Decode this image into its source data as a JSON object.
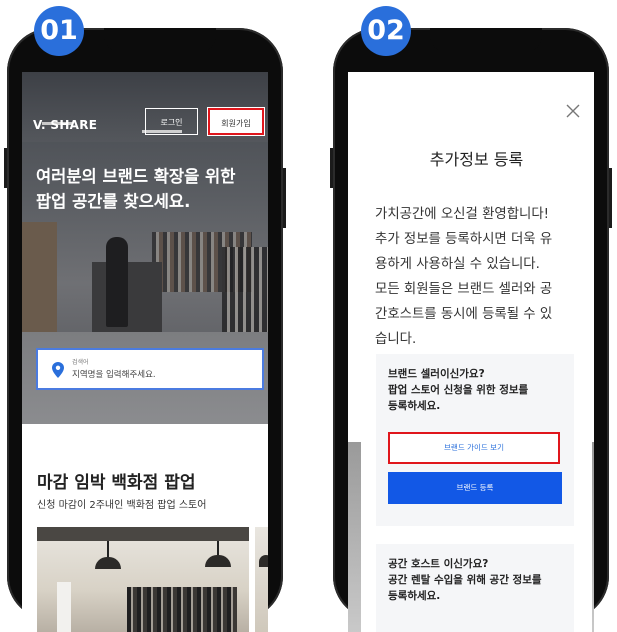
{
  "badges": {
    "step1": "01",
    "step2": "02"
  },
  "colors": {
    "badge": "#2a6fdb",
    "primary_button": "#1258e6",
    "highlight_border": "#e0161c"
  },
  "screen1": {
    "logo": "V. SHARE",
    "header": {
      "login_label": "로그인",
      "signup_label": "회원가입"
    },
    "hero": {
      "title_line1": "여러분의 브랜드 확장을 위한",
      "title_line2": "팝업 공간를 찾으세요."
    },
    "search": {
      "label": "검색어",
      "placeholder": "지역명을 입력해주세요.",
      "icon": "map-pin-icon"
    },
    "section": {
      "title": "마감 임박 백화점 팝업",
      "subtitle": "신청 마감이 2주내인 백화점 팝업 스토어"
    }
  },
  "screen2": {
    "close_icon": "close-icon",
    "title": "추가정보 등록",
    "body_lines": [
      "가치공간에 오신걸 환영합니다!",
      "추가 정보를 등록하시면 더욱 유",
      "용하게 사용하실 수 있습니다.",
      "모든 회원들은 브랜드 셀러와 공",
      "간호스트를 동시에 등록될 수 있",
      "습니다."
    ],
    "brand_card": {
      "lines": [
        "브랜드 셀러이신가요?",
        "팝업 스토어 신청을 위한 정보를",
        "등록하세요."
      ],
      "guide_button": "브랜드 가이드 보기",
      "register_button": "브랜드 등록"
    },
    "host_card": {
      "lines": [
        "공간 호스트 이신가요?",
        "공간 렌탈 수입을 위해 공간 정보를",
        "등록하세요."
      ]
    }
  }
}
